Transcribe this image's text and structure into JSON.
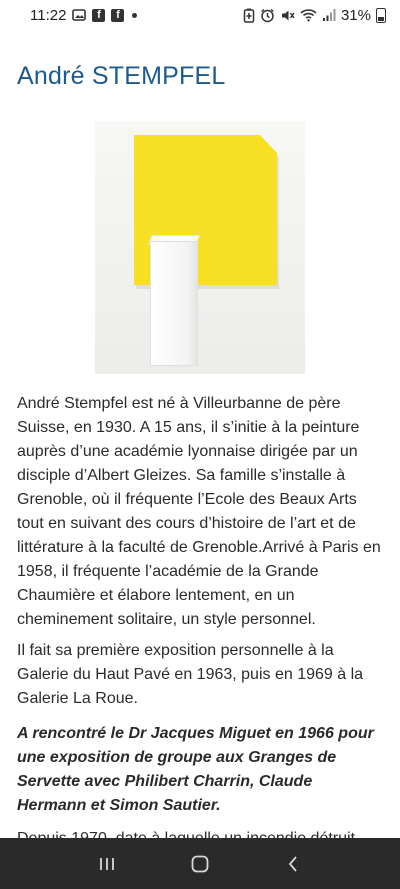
{
  "status_bar": {
    "time": "11:22",
    "battery_percent": "31%",
    "left_icons": [
      "image-icon",
      "facebook-icon",
      "facebook-icon",
      "dot-icon"
    ],
    "right_icons": [
      "battery-saver-icon",
      "alarm-icon",
      "mute-icon",
      "wifi-icon",
      "signal-icon",
      "battery-icon"
    ]
  },
  "page": {
    "title": "André STEMPFEL",
    "artwork_alt": "",
    "paragraphs": [
      "André Stempfel est né à Villeurbanne de père Suisse, en 1930. A 15 ans, il s’initie à la peinture auprès d’une académie lyonnaise dirigée par un disciple d’Albert Gleizes. Sa famille s’installe à Grenoble, où il fréquente l’Ecole des Beaux Arts tout en suivant des cours d’histoire de l’art et de littérature à la faculté de Grenoble.Arrivé à Paris en 1958, il fréquente l’académie de la Grande Chaumière et élabore lentement, en un cheminement solitaire, un style personnel.",
      "Il fait sa première exposition personnelle à la Galerie du Haut Pavé en 1963, puis en 1969 à la Galerie La Roue.",
      "A rencontré le Dr Jacques Miguet en 1966 pour une exposition de groupe aux Granges de Servette avec Philibert Charrin, Claude Hermann et Simon Sautier.",
      "Depuis 1970, date à laquelle un incendie détruit"
    ]
  },
  "colors": {
    "title": "#1d5a8e",
    "artwork_yellow": "#f7df24",
    "nav_bar": "#2a2a2a"
  },
  "nav_bar": {
    "buttons": [
      "recent-apps-icon",
      "home-icon",
      "back-icon"
    ]
  }
}
